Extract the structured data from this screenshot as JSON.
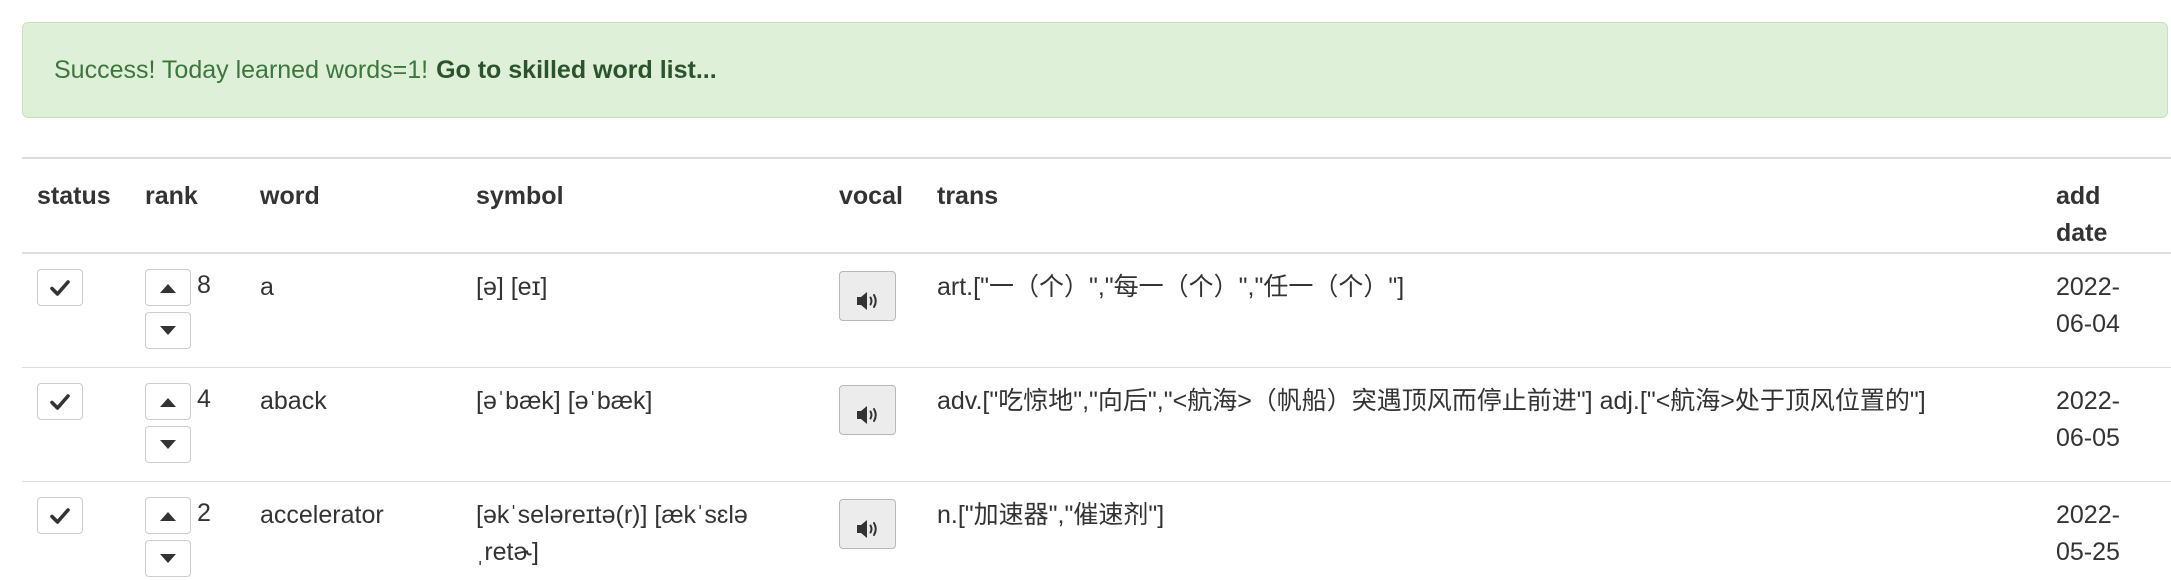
{
  "alert": {
    "message": "Success! Today learned words=1!",
    "link_label": "Go to skilled word list..."
  },
  "table": {
    "headers": {
      "status": "status",
      "rank": "rank",
      "word": "word",
      "symbol": "symbol",
      "vocal": "vocal",
      "trans": "trans",
      "add_date_line1": "add",
      "add_date_line2": "date"
    },
    "rows": [
      {
        "rank": "8",
        "word": "a",
        "symbol": "[ə] [eɪ]",
        "trans": "art.[\"一（个）\",\"每一（个）\",\"任一（个）\"]",
        "date_line1": "2022-",
        "date_line2": "06-04"
      },
      {
        "rank": "4",
        "word": "aback",
        "symbol": "[əˈbæk] [əˈbæk]",
        "trans": "adv.[\"吃惊地\",\"向后\",\"<航海>（帆船）突遇顶风而停止前进\"] adj.[\"<航海>处于顶风位置的\"]",
        "date_line1": "2022-",
        "date_line2": "06-05"
      },
      {
        "rank": "2",
        "word": "accelerator",
        "symbol_line1": "[əkˈseləreɪtə(r)] [ækˈsɛlə",
        "symbol_line2": "ˌretɚ]",
        "trans": "n.[\"加速器\",\"催速剂\"]",
        "date_line1": "2022-",
        "date_line2": "05-25"
      }
    ]
  },
  "icons": {
    "status": "checkmark-icon",
    "rank_up": "caret-up-icon",
    "rank_down": "caret-down-icon",
    "vocal": "volume-icon"
  }
}
